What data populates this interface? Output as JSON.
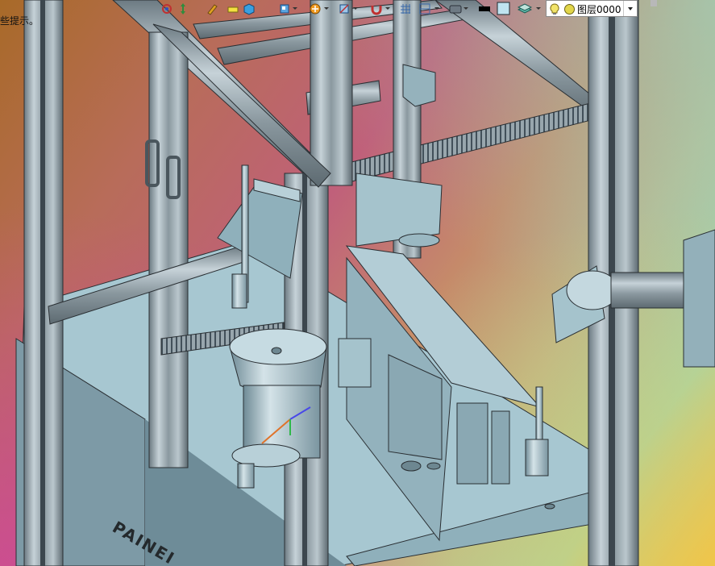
{
  "status_hint": "些提示。",
  "toolbar": {
    "layer": {
      "name": "图层0000",
      "state_icons": [
        "lightbulb-icon",
        "sun-icon"
      ]
    },
    "color_swatches": {
      "linetype_color": "#000000",
      "fill_color": "#bfe3f0"
    }
  },
  "model": {
    "engraved_text": "PAINEI",
    "colors": {
      "frame_profile": "#9aa8b0",
      "frame_dark": "#5a666e",
      "plate": "#a8c8d2",
      "housing": "#7d9aa6",
      "edge_line": "#2a2f33"
    }
  },
  "colors": {
    "viewport_gradient": [
      "#a86a28",
      "#c0607a",
      "#9fd6b4",
      "#f0c24e"
    ]
  }
}
